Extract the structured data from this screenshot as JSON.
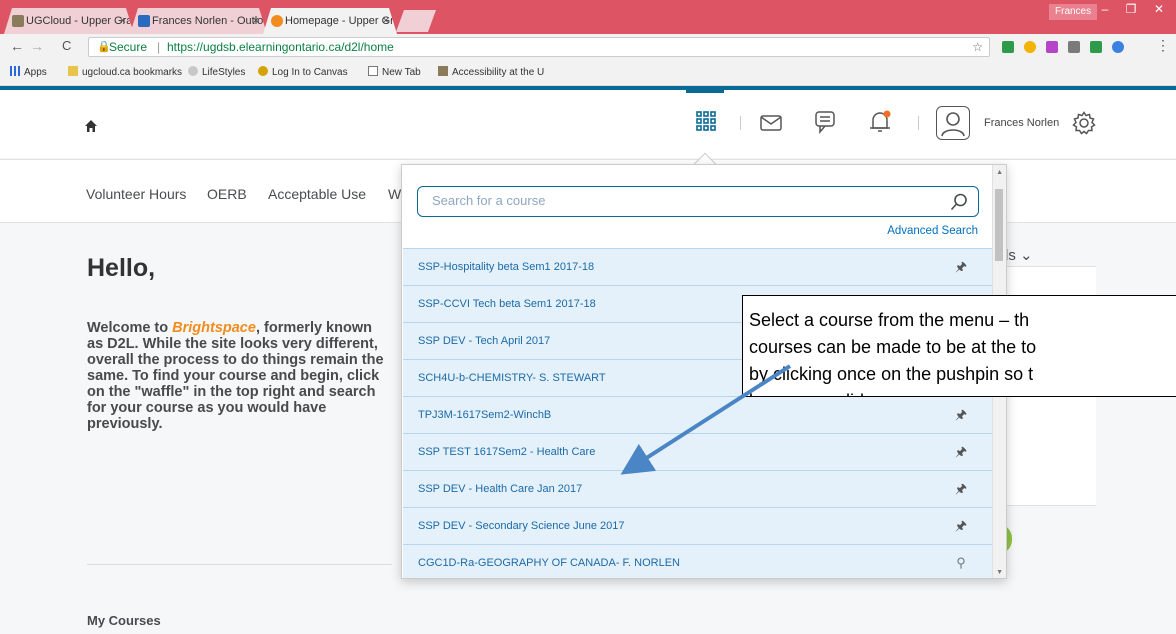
{
  "browser": {
    "tabs": [
      {
        "label": "UGCloud - Upper Grand",
        "icon": "ugcloud-icon",
        "color": "#8a7b5a"
      },
      {
        "label": "Frances Norlen - Outlool",
        "icon": "outlook-icon",
        "color": "#2b6bbf"
      },
      {
        "label": "Homepage - Upper Gran",
        "icon": "brightspace-icon",
        "color": "#f28c1e"
      }
    ],
    "profile_name": "Frances",
    "close_glyph": "×",
    "window_controls": {
      "minimize": "–",
      "restore": "❐",
      "close": "✕"
    },
    "url": {
      "secure_label": "Secure",
      "separator": "|",
      "address": "https://ugdsb.elearningontario.ca/d2l/home"
    },
    "bookmarks": [
      {
        "label": "Apps",
        "icon": "apps-grid-icon"
      },
      {
        "label": "ugcloud.ca bookmarks",
        "icon": "folder-icon"
      },
      {
        "label": "LifeStyles",
        "icon": "lifestyles-icon"
      },
      {
        "label": "Log In to Canvas",
        "icon": "canvas-icon"
      },
      {
        "label": "New Tab",
        "icon": "page-icon"
      },
      {
        "label": "Accessibility at the U",
        "icon": "ugcloud-icon"
      }
    ]
  },
  "header": {
    "user_name": "Frances Norlen",
    "icons": [
      "home-icon",
      "waffle-grid-icon",
      "mail-icon",
      "chat-icon",
      "bell-icon",
      "avatar-icon",
      "gear-icon"
    ],
    "notification_color": "#f36f21"
  },
  "nav": {
    "links": [
      "Volunteer Hours",
      "OERB",
      "Acceptable Use",
      "W"
    ]
  },
  "main": {
    "greeting": "Hello,",
    "welcome_before": "Welcome to ",
    "brand": "Brightspace",
    "welcome_after": ", formerly known as D2L.  While the site looks very different, overall the process to do things remain the same.  To find your course and begin, click on the \"waffle\" in the top right and search for your course as you would have previously.",
    "my_courses": "My Courses",
    "right_heading": "ds ⌄"
  },
  "course_selector": {
    "search_placeholder": "Search for a course",
    "advanced_search": "Advanced Search",
    "courses": [
      {
        "name": "SSP-Hospitality beta Sem1 2017-18",
        "pinned": true
      },
      {
        "name": "SSP-CCVI Tech beta Sem1 2017-18",
        "pinned": true
      },
      {
        "name": "SSP DEV - Tech April 2017",
        "pinned": true
      },
      {
        "name": "SCH4U-b-CHEMISTRY- S. STEWART",
        "pinned": true
      },
      {
        "name": "TPJ3M-1617Sem2-WinchB",
        "pinned": true
      },
      {
        "name": "SSP TEST 1617Sem2 - Health Care",
        "pinned": true
      },
      {
        "name": "SSP DEV - Health Care Jan 2017",
        "pinned": true
      },
      {
        "name": "SSP DEV - Secondary Science June 2017",
        "pinned": true
      },
      {
        "name": "CGC1D-Ra-GEOGRAPHY OF CANADA- F. NORLEN",
        "pinned": false
      }
    ]
  },
  "callout": {
    "text": "Select a course from the menu – the courses can be made to be at the top by clicking once on the pushpin so that it becomes solid",
    "line1": "Select a course from the menu – th",
    "line2": "courses can be made to be at the to",
    "line3": "by clicking once on the pushpin so t",
    "line4": "becomes solid",
    "arrow_color": "#4a86c5"
  }
}
